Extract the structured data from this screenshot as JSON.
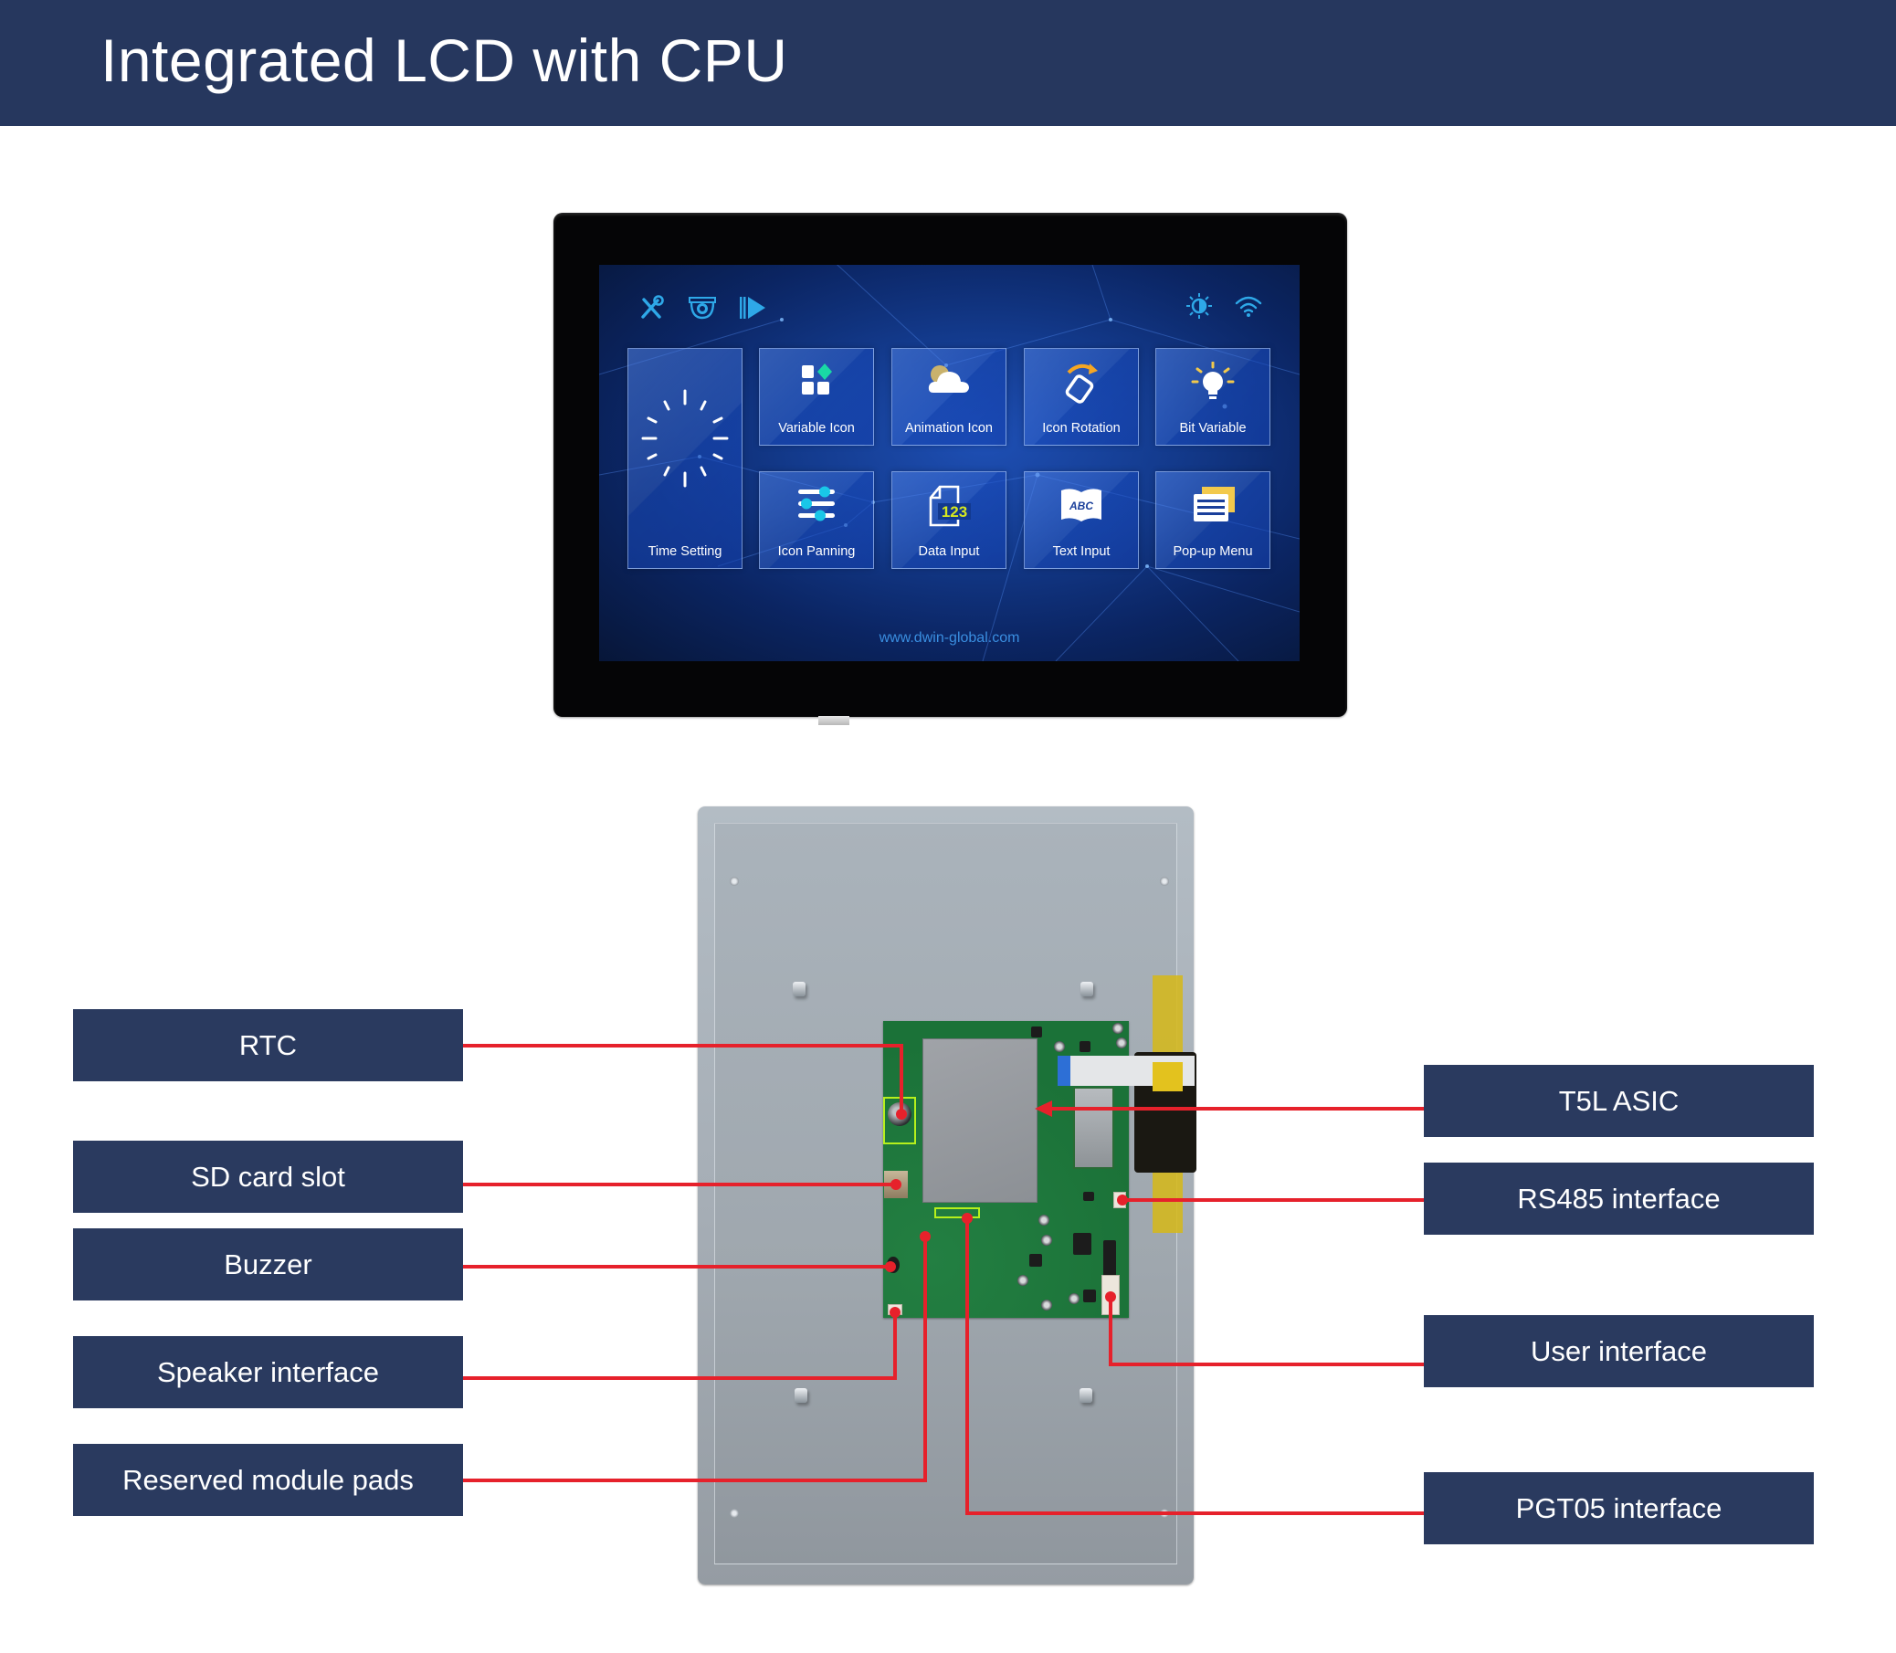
{
  "header": {
    "title": "Integrated LCD with CPU"
  },
  "colors": {
    "header_bg": "#26375e",
    "label_bg": "#2a3a5f",
    "callout_red": "#e6212b",
    "screen_icon": "#2ea8e8",
    "highlight": "#b6f01c"
  },
  "lcd_screen": {
    "status_icons_left": [
      "wrench-screwdriver-icon",
      "camera-dome-icon",
      "play-icon"
    ],
    "status_icons_right": [
      "brightness-icon",
      "wifi-icon"
    ],
    "tiles": [
      {
        "label": "Time Setting",
        "icon": "clock-icon"
      },
      {
        "label": "Variable Icon",
        "icon": "grid-diamond-icon"
      },
      {
        "label": "Animation Icon",
        "icon": "cloud-sun-icon"
      },
      {
        "label": "Icon Rotation",
        "icon": "rotate-icon"
      },
      {
        "label": "Bit Variable",
        "icon": "lightbulb-icon"
      },
      {
        "label": "Icon Panning",
        "icon": "sliders-icon"
      },
      {
        "label": "Data Input",
        "icon": "document-123-icon"
      },
      {
        "label": "Text Input",
        "icon": "book-abc-icon"
      },
      {
        "label": "Pop-up Menu",
        "icon": "menu-cards-icon"
      }
    ],
    "data_input_icon_text": "123",
    "text_input_icon_text": "ABC",
    "url": "www.dwin-global.com"
  },
  "callouts": {
    "left": [
      {
        "label": "RTC"
      },
      {
        "label": "SD card slot"
      },
      {
        "label": "Buzzer"
      },
      {
        "label": "Speaker interface"
      },
      {
        "label": "Reserved module pads"
      }
    ],
    "right": [
      {
        "label": "T5L ASIC"
      },
      {
        "label": "RS485 interface"
      },
      {
        "label": "User interface"
      },
      {
        "label": "PGT05 interface"
      }
    ]
  }
}
